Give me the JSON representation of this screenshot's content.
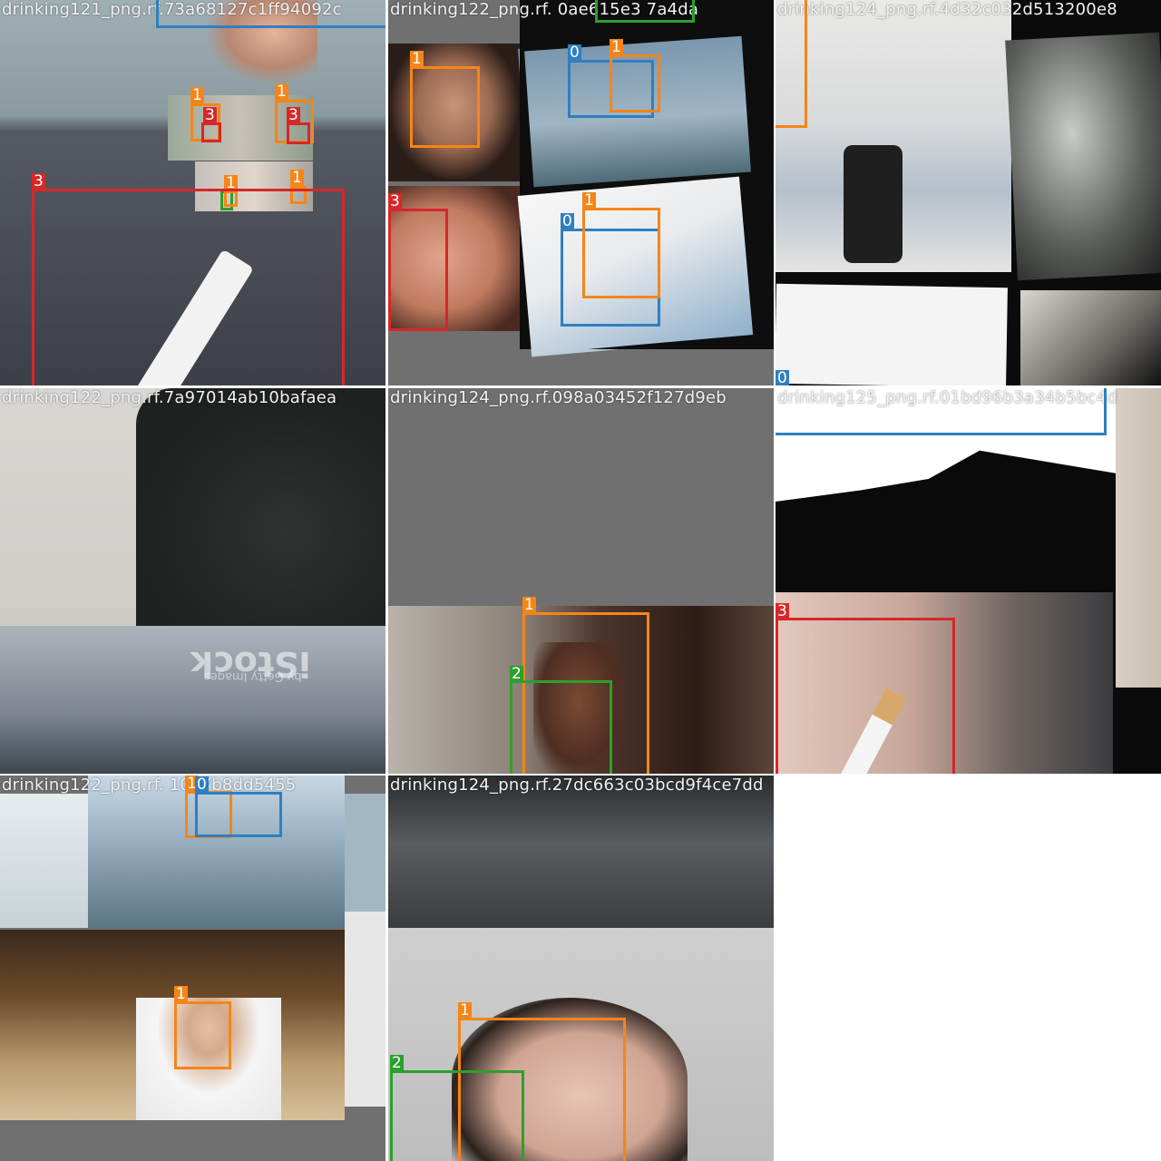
{
  "tiles": [
    {
      "filename": "drinking121_png.rf.73a68127c1ff94092c"
    },
    {
      "filename": "drinking122_png.rf.   0ae615e3   7a4da"
    },
    {
      "filename": "drinking124_png.rf.4d32c032d513200e8"
    },
    {
      "filename": "drinking122_png.rf.7a97014ab10bafaea"
    },
    {
      "filename": "drinking124_png.rf.098a03452f127d9eb"
    },
    {
      "filename": "drinking125_png.rf.01bd96b3a34b5bc4d"
    },
    {
      "filename": "drinking122_png.rf.   1097b8dd5455"
    },
    {
      "filename": "drinking124_png.rf.27dc663c03bcd9f4ce7dd"
    }
  ],
  "class_labels": {
    "c0": "0",
    "c1": "1",
    "c2": "2",
    "c3": "3"
  },
  "watermark": "iStock",
  "watermark_sub": "by Getty Images",
  "colors": {
    "class0": "#2f7fc1",
    "class1": "#f58519",
    "class2": "#2ca02c",
    "class3": "#d62728"
  }
}
